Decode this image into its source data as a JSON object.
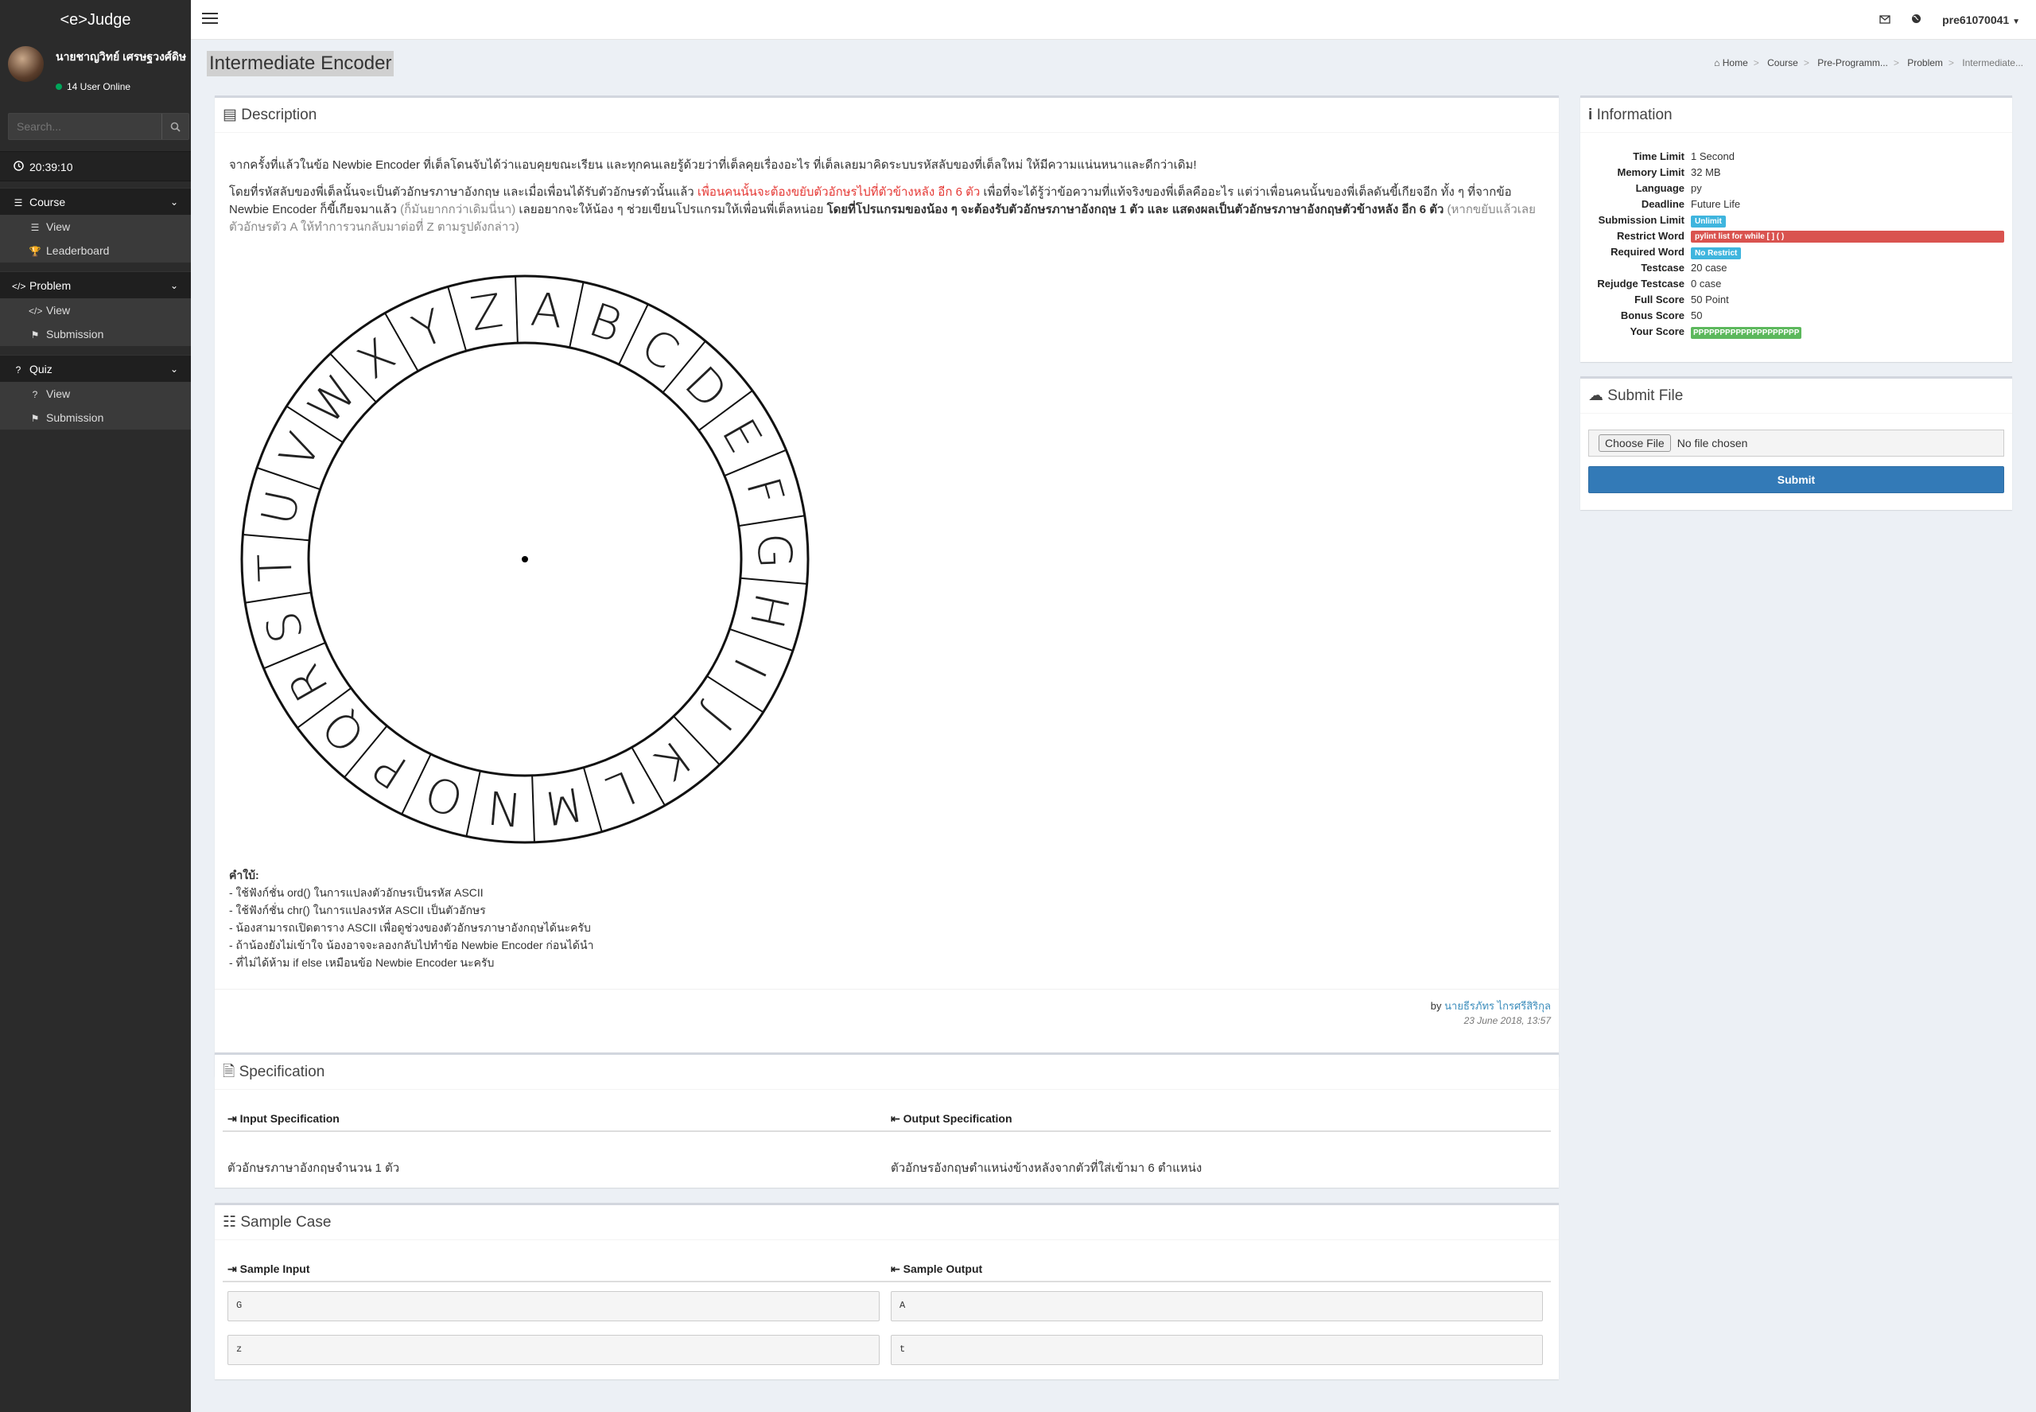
{
  "app": {
    "brand": "<e>Judge"
  },
  "user": {
    "name": "นายชาญวิทย์ เศรษฐวงศ์ดิษ",
    "online": "14 User Online",
    "username": "pre61070041"
  },
  "search": {
    "placeholder": "Search..."
  },
  "clock": "20:39:10",
  "menu": [
    {
      "label": "Course",
      "icon": "list-icon",
      "items": [
        {
          "label": "View",
          "icon": "list-icon"
        },
        {
          "label": "Leaderboard",
          "icon": "trophy-icon"
        }
      ]
    },
    {
      "label": "Problem",
      "icon": "code-icon",
      "items": [
        {
          "label": "View",
          "icon": "code-icon"
        },
        {
          "label": "Submission",
          "icon": "flag-icon"
        }
      ]
    },
    {
      "label": "Quiz",
      "icon": "question-icon",
      "items": [
        {
          "label": "View",
          "icon": "question-icon"
        },
        {
          "label": "Submission",
          "icon": "flag-icon"
        }
      ]
    }
  ],
  "page": {
    "title": "Intermediate Encoder"
  },
  "breadcrumb": [
    "Home",
    "Course",
    "Pre-Programm...",
    "Problem",
    "Intermediate..."
  ],
  "description": {
    "heading": "Description",
    "p1": "จากครั้งที่แล้วในข้อ Newbie Encoder ที่เต็ลโดนจับได้ว่าแอบคุยขณะเรียน และทุกคนเลยรู้ด้วยว่าที่เต็ลคุยเรื่องอะไร ที่เต็ลเลยมาคิดระบบรหัสลับของที่เต็ลใหม่ ให้มีความแน่นหนาและดีกว่าเดิม!",
    "p2a": "โดยที่รหัสลับของพี่เต็ลนั้นจะเป็นตัวอักษรภาษาอังกฤษ และเมื่อเพื่อนได้รับตัวอักษรตัวนั้นแล้ว ",
    "p2b": "เพื่อนคนนั้นจะต้องขยับตัวอักษรไปที่ตัวข้างหลัง อีก 6 ตัว",
    "p2c": " เพื่อที่จะได้รู้ว่าข้อความที่แท้จริงของพี่เต็ลคืออะไร แต่ว่าเพื่อนคนนั้นของพี่เต็ลดันขี้เกียจอีก ทั้ง ๆ ที่จากข้อ Newbie Encoder ก็ขี้เกียจมาแล้ว ",
    "p2d": "(ก็มันยากกว่าเดิมนี่นา)",
    "p2e": " เลยอยากจะให้น้อง ๆ ช่วยเขียนโปรแกรมให้เพื่อนพี่เต็ลหน่อย ",
    "p2f": "โดยที่โปรแกรมของน้อง ๆ จะต้องรับตัวอักษรภาษาอังกฤษ 1 ตัว และ แสดงผลเป็นตัวอักษรภาษาอังกฤษตัวข้างหลัง อีก 6 ตัว",
    "p2g": " (หากขยับแล้วเลยตัวอักษรตัว A ให้ทำการวนกลับมาต่อที่ Z ตามรูปดังกล่าว)",
    "wheel_letters": [
      "A",
      "B",
      "C",
      "D",
      "E",
      "F",
      "G",
      "H",
      "I",
      "J",
      "K",
      "L",
      "M",
      "N",
      "O",
      "P",
      "Q",
      "R",
      "S",
      "T",
      "U",
      "V",
      "W",
      "X",
      "Y",
      "Z"
    ],
    "hints_title": "คำใบ้:",
    "hints": [
      "- ใช้ฟังก์ชั่น ord() ในการแปลงตัวอักษรเป็นรหัส ASCII",
      "- ใช้ฟังก์ชั่น chr() ในการแปลงรหัส ASCII เป็นตัวอักษร",
      "- น้องสามารถเปิดตาราง ASCII เพื่อดูช่วงของตัวอักษรภาษาอังกฤษได้นะครับ",
      "- ถ้าน้องยังไม่เข้าใจ น้องอาจจะลองกลับไปทำข้อ Newbie Encoder ก่อนได้นำ",
      "- ที่ไม่ได้ห้าม if else เหมือนข้อ Newbie Encoder นะครับ"
    ],
    "by": "by",
    "author": "นายธีรภัทร ไกรศรีสิริกุล",
    "date": "23 June 2018, 13:57"
  },
  "specification": {
    "heading": "Specification",
    "input_label": "Input Specification",
    "output_label": "Output Specification",
    "input_text": "ตัวอักษรภาษาอังกฤษจำนวน 1 ตัว",
    "output_text": "ตัวอักษรอังกฤษตำแหน่งข้างหลังจากตัวที่ใส่เข้ามา 6 ตำแหน่ง"
  },
  "samples": {
    "heading": "Sample Case",
    "input_label": "Sample Input",
    "output_label": "Sample Output",
    "rows": [
      {
        "input": "G",
        "output": "A"
      },
      {
        "input": "z",
        "output": "t"
      }
    ]
  },
  "information": {
    "heading": "Information",
    "rows": [
      {
        "k": "Time Limit",
        "v": "1 Second"
      },
      {
        "k": "Memory Limit",
        "v": "32 MB"
      },
      {
        "k": "Language",
        "v": "py"
      },
      {
        "k": "Deadline",
        "v": "Future Life"
      },
      {
        "k": "Submission Limit",
        "badge": "Unlimit",
        "color": "#3fb5de"
      },
      {
        "k": "Restrict Word",
        "badge": "pylint list for while [ ] ( )",
        "color": "#d9534f"
      },
      {
        "k": "Required Word",
        "badge": "No Restrict",
        "color": "#3fb5de"
      },
      {
        "k": "Testcase",
        "v": "20 case"
      },
      {
        "k": "Rejudge Testcase",
        "v": "0 case"
      },
      {
        "k": "Full Score",
        "v": "50 Point"
      },
      {
        "k": "Bonus Score",
        "v": "50"
      },
      {
        "k": "Your Score",
        "badge": "PPPPPPPPPPPPPPPPPPPP",
        "color": "#5cb85c"
      }
    ]
  },
  "submit": {
    "heading": "Submit File",
    "choose": "Choose File",
    "nofile": "No file chosen",
    "button": "Submit"
  }
}
